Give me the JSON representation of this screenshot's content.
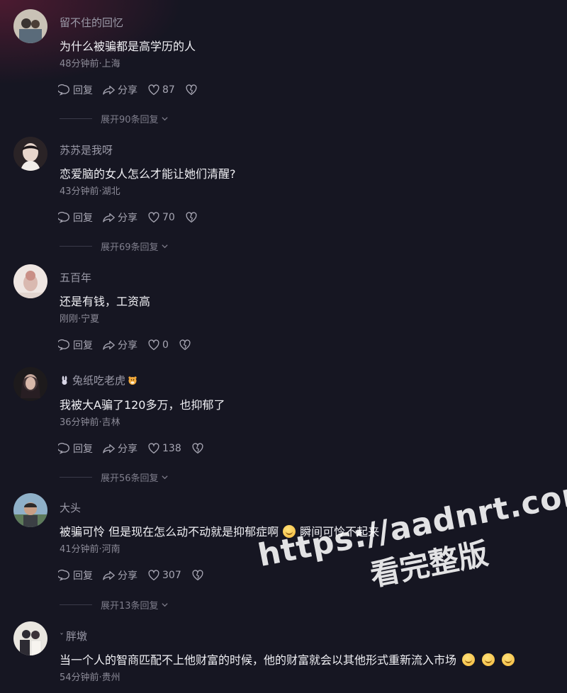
{
  "comments": [
    {
      "username": "留不住的回忆",
      "text": "为什么被骗都是高学历的人",
      "time_location": "48分钟前·上海",
      "reply_label": "回复",
      "share_label": "分享",
      "likes": "87",
      "expand_label": "展开90条回复",
      "avatar_colors": [
        "#c9c2b6",
        "#5a6b7a"
      ]
    },
    {
      "username": "苏苏是我呀",
      "text": "恋爱脑的女人怎么才能让她们清醒?",
      "time_location": "43分钟前·湖北",
      "reply_label": "回复",
      "share_label": "分享",
      "likes": "70",
      "expand_label": "展开69条回复",
      "avatar_colors": [
        "#e8d6cc",
        "#2a2326"
      ]
    },
    {
      "username": "五百年",
      "text": "还是有钱，工资高",
      "time_location": "刚刚·宁夏",
      "reply_label": "回复",
      "share_label": "分享",
      "likes": "0",
      "expand_label": "",
      "avatar_colors": [
        "#efe6e2",
        "#c98f86"
      ]
    },
    {
      "username": "兔纸吃老虎",
      "text": "我被大A骗了120多万，也抑郁了",
      "time_location": "36分钟前·吉林",
      "reply_label": "回复",
      "share_label": "分享",
      "likes": "138",
      "expand_label": "展开56条回复",
      "avatar_colors": [
        "#6b5c58",
        "#1d1a1c"
      ]
    },
    {
      "username": "大头",
      "text_before": "被骗可怜 但是现在怎么动不动就是抑郁症啊",
      "text_after": "瞬间可怜不起来",
      "time_location": "41分钟前·河南",
      "reply_label": "回复",
      "share_label": "分享",
      "likes": "307",
      "expand_label": "展开13条回复",
      "avatar_colors": [
        "#8fb0c8",
        "#3b3f44"
      ]
    },
    {
      "username": "胖墩",
      "text": "当一个人的智商匹配不上他财富的时候，他的财富就会以其他形式重新流入市场",
      "time_location": "54分钟前·贵州",
      "avatar_colors": [
        "#e9e6e0",
        "#2d2b33"
      ]
    }
  ],
  "watermark": {
    "line1": "https://aadnrt.com",
    "line2": "看完整版"
  },
  "icons": {
    "reply": "speech-bubble-icon",
    "share": "share-arrow-icon",
    "like": "heart-icon",
    "dislike": "broken-heart-icon",
    "expand": "chevron-down-icon"
  }
}
